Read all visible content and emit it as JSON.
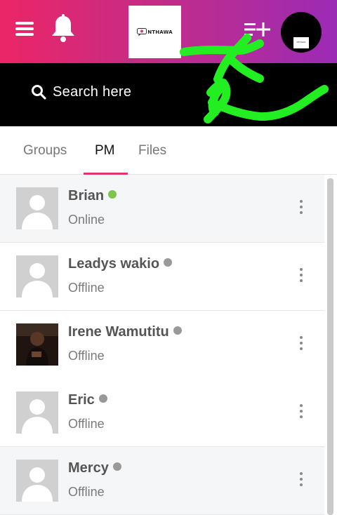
{
  "header": {
    "logo_text": "NTHAWA",
    "mini_logo_text": "NTHAWA"
  },
  "search": {
    "placeholder": "Search here"
  },
  "tabs": [
    {
      "label": "Groups",
      "active": false
    },
    {
      "label": "PM",
      "active": true
    },
    {
      "label": "Files",
      "active": false
    }
  ],
  "contacts": [
    {
      "name": "Brian",
      "status": "Online",
      "presence": "online",
      "avatar": "default"
    },
    {
      "name": "Leadys wakio",
      "status": "Offline",
      "presence": "offline",
      "avatar": "default"
    },
    {
      "name": "Irene Wamutitu",
      "status": "Offline",
      "presence": "offline",
      "avatar": "photo"
    },
    {
      "name": "Eric",
      "status": "Offline",
      "presence": "offline",
      "avatar": "default"
    },
    {
      "name": "Mercy",
      "status": "Offline",
      "presence": "offline",
      "avatar": "default"
    }
  ],
  "colors": {
    "gradient_start": "#ec2566",
    "gradient_end": "#9b2bb5",
    "active_tab_underline": "#e7336c",
    "online_dot": "#7cc54a",
    "offline_dot": "#999999",
    "scribble": "#22ee22"
  }
}
